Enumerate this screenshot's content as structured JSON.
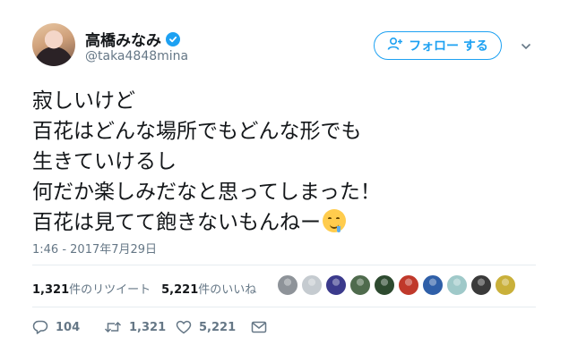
{
  "user": {
    "display_name": "高橋みなみ",
    "handle": "@taka4848mina",
    "verified": true
  },
  "follow_button": {
    "label": "フォロー する",
    "icon": "add-user-icon"
  },
  "tweet": {
    "lines": [
      "寂しいけど",
      "百花はどんな場所でもどんな形でも",
      "生きていけるし",
      "何だか楽しみだなと思ってしまった！",
      "百花は見てて飽きないもんねー"
    ],
    "emoji": "drooling-face-emoji",
    "timestamp": "1:46 - 2017年7月29日"
  },
  "stats": {
    "retweets_count": "1,321",
    "retweets_label": "件のリツイート",
    "likes_count": "5,221",
    "likes_label": "件のいいね"
  },
  "likers_colors": [
    "#8e9399",
    "#c5cbd0",
    "#3b3a8c",
    "#4f6b4d",
    "#2d4a2f",
    "#c0392b",
    "#2f5fa8",
    "#9fc9c9",
    "#3a3a3a",
    "#c9b03a"
  ],
  "actions": {
    "reply_count": "104",
    "retweet_count": "1,321",
    "like_count": "5,221"
  },
  "colors": {
    "accent": "#1da1f2",
    "muted": "#657786",
    "text": "#14171a"
  }
}
